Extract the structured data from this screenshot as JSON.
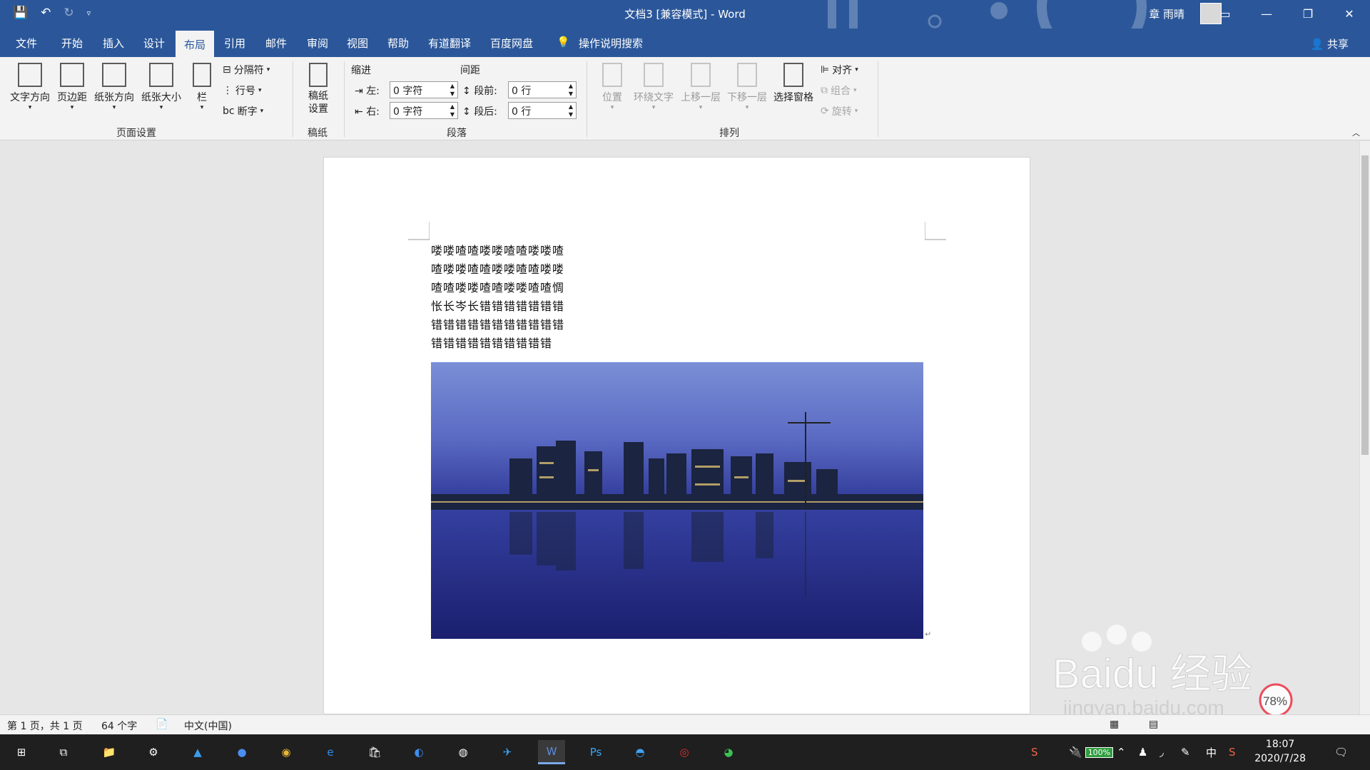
{
  "app": {
    "title": "文档3 [兼容模式] - Word",
    "user": "章 雨晴",
    "share": "共享"
  },
  "tabs": [
    "文件",
    "开始",
    "插入",
    "设计",
    "布局",
    "引用",
    "邮件",
    "审阅",
    "视图",
    "帮助",
    "有道翻译",
    "百度网盘"
  ],
  "active_tab": "布局",
  "tell_me": "操作说明搜索",
  "ribbon": {
    "page_setup": {
      "text_direction": "文字方向",
      "margins": "页边距",
      "orientation": "纸张方向",
      "size": "纸张大小",
      "columns": "栏",
      "breaks": "分隔符",
      "line_numbers": "行号",
      "hyphenation": "断字",
      "group": "页面设置"
    },
    "manuscript": {
      "button": "稿纸\n设置",
      "group": "稿纸"
    },
    "paragraph": {
      "indent": "缩进",
      "spacing": "间距",
      "left": "左:",
      "right": "右:",
      "before": "段前:",
      "after": "段后:",
      "left_val": "0 字符",
      "right_val": "0 字符",
      "before_val": "0 行",
      "after_val": "0 行",
      "group": "段落"
    },
    "arrange": {
      "position": "位置",
      "wrap": "环绕文字",
      "forward": "上移一层",
      "backward": "下移一层",
      "selection_pane": "选择窗格",
      "align": "对齐",
      "group_btn": "组合",
      "rotate": "旋转",
      "group": "排列"
    }
  },
  "document": {
    "lines": [
      "喽喽喳喳喽喽喳喳喽喽喳",
      "喳喽喽喳喳喽喽喳喳喽喽",
      "喳喳喽喽喳喳喽喽喳喳惆",
      "怅长岑长错错错错错错错",
      "错错错错错错错错错错错",
      "错错错错错错错错错错"
    ]
  },
  "status": {
    "page": "第 1 页，共 1 页",
    "words": "64 个字",
    "lang": "中文(中国)"
  },
  "taskbar": {
    "time": "18:07",
    "date": "2020/7/28",
    "battery": "100%",
    "ime": "中"
  },
  "watermark": {
    "brand": "Baidu 经验",
    "url": "jingyan.baidu.com",
    "speed": "78%"
  }
}
